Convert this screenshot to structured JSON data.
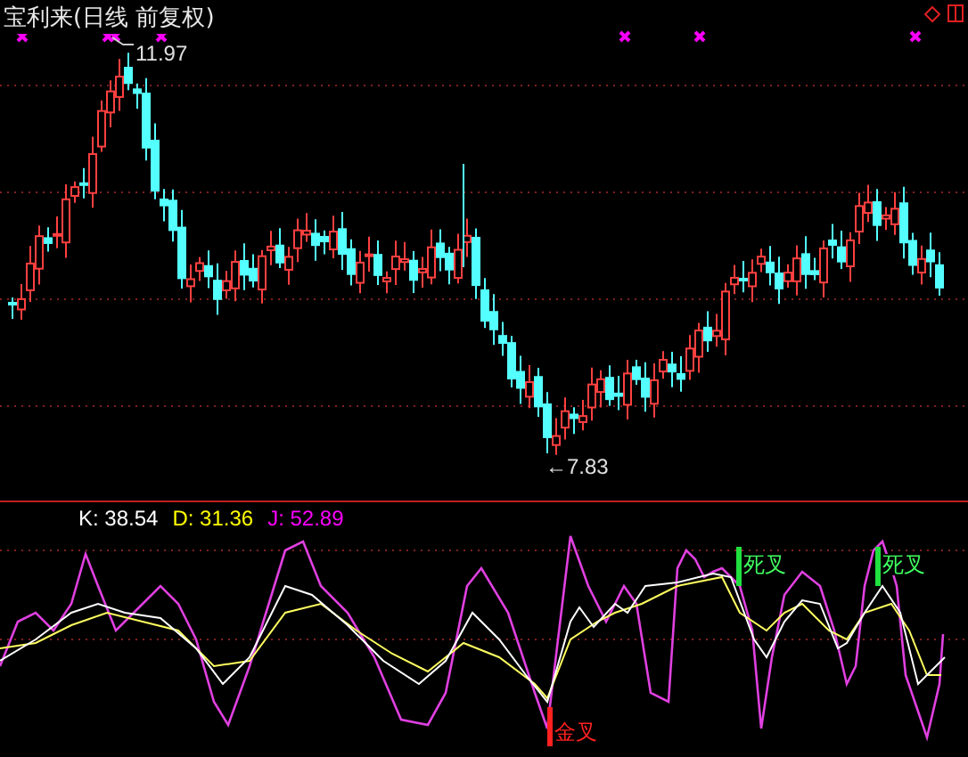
{
  "title": "宝利来(日线 前复权)",
  "price_labels": [
    {
      "kind": "high",
      "text": "11.97"
    },
    {
      "kind": "low",
      "text": "←7.83"
    }
  ],
  "indicator": {
    "values": [
      {
        "label": "K: 38.54",
        "color": "#ffffff"
      },
      {
        "label": "D: 31.36",
        "color": "#ffff00"
      },
      {
        "label": "J: 52.89",
        "color": "#ff00ff"
      }
    ]
  },
  "signals": [
    {
      "kind": "golden",
      "text": "金叉"
    },
    {
      "kind": "death",
      "text": "死叉"
    },
    {
      "kind": "death",
      "text": "死叉"
    }
  ]
}
